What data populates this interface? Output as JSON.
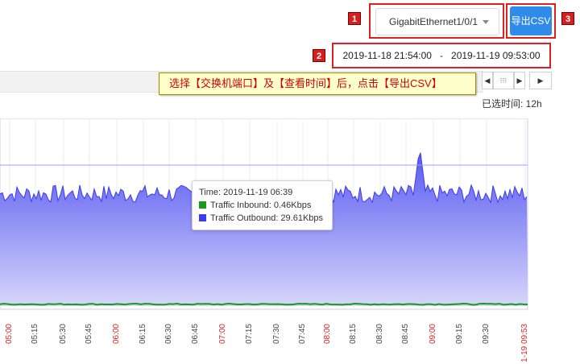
{
  "controls": {
    "interface_select": {
      "value": "GigabitEthernet1/0/1"
    },
    "export_button": {
      "label": "导出CSV"
    },
    "date_range": {
      "start": "2019-11-18 21:54:00",
      "separator": "-",
      "end": "2019-11-19 09:53:00"
    },
    "tip_text": "选择【交换机端口】及【查看时间】后，点击【导出CSV】",
    "selected_time": "已选时间: 12h",
    "nav_prev": "◀",
    "nav_grip": "⁝⁝⁝",
    "nav_next": "▶",
    "nav_next2": "▶"
  },
  "badges": [
    "1",
    "2",
    "3"
  ],
  "colors": {
    "accent": "#2f8bea",
    "annotation_red": "#e02020",
    "inbound": "#1a9a1a",
    "outbound": "#3b3bf0",
    "area_fill": "#6a6af5",
    "tip_bg": "#ffffcc"
  },
  "tooltip": {
    "time": "Time: 2019-11-19 06:39",
    "inbound": "Traffic Inbound: 0.46Kbps",
    "outbound": "Traffic Outbound: 29.61Kbps"
  },
  "chart_data": {
    "type": "area",
    "x_tick_labels": [
      "05:00",
      "05:15",
      "05:30",
      "05:45",
      "06:00",
      "06:15",
      "06:30",
      "06:45",
      "07:00",
      "07:15",
      "07:30",
      "07:45",
      "08:00",
      "08:15",
      "08:30",
      "08:45",
      "09:00",
      "09:15",
      "09:30",
      "1-19 09:53"
    ],
    "highlighted_ticks": [
      "05:00",
      "06:00",
      "07:00",
      "08:00",
      "09:00",
      "1-19 09:53"
    ],
    "series": [
      {
        "name": "Traffic Inbound",
        "unit": "Kbps",
        "approx_level": 0.46
      },
      {
        "name": "Traffic Outbound",
        "unit": "Kbps",
        "approx_level": 29.6,
        "spike_time": "08:48",
        "spike_value": 40
      }
    ],
    "grid": true
  }
}
